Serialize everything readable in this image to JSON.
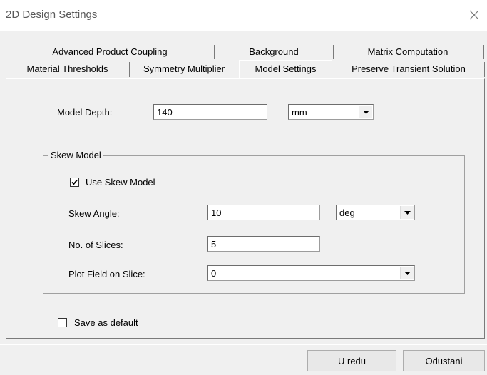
{
  "window": {
    "title": "2D Design Settings",
    "close_icon": "close-icon"
  },
  "tabs": {
    "row1": [
      {
        "label": "Advanced Product Coupling"
      },
      {
        "label": "Background"
      },
      {
        "label": "Matrix Computation"
      }
    ],
    "row2": [
      {
        "label": "Material Thresholds"
      },
      {
        "label": "Symmetry Multiplier"
      },
      {
        "label": "Model Settings",
        "active": true
      },
      {
        "label": "Preserve Transient Solution"
      }
    ]
  },
  "model_depth": {
    "label": "Model Depth:",
    "value": "140",
    "unit": "mm"
  },
  "skew_model": {
    "group_title": "Skew Model",
    "use_skew": {
      "label": "Use Skew Model",
      "checked": true
    },
    "skew_angle": {
      "label": "Skew Angle:",
      "value": "10",
      "unit": "deg"
    },
    "slices": {
      "label": "No. of Slices:",
      "value": "5"
    },
    "plot_field": {
      "label": "Plot Field on Slice:",
      "value": "0"
    }
  },
  "save_default": {
    "label": "Save as default",
    "checked": false
  },
  "buttons": {
    "ok": "U redu",
    "cancel": "Odustani"
  }
}
